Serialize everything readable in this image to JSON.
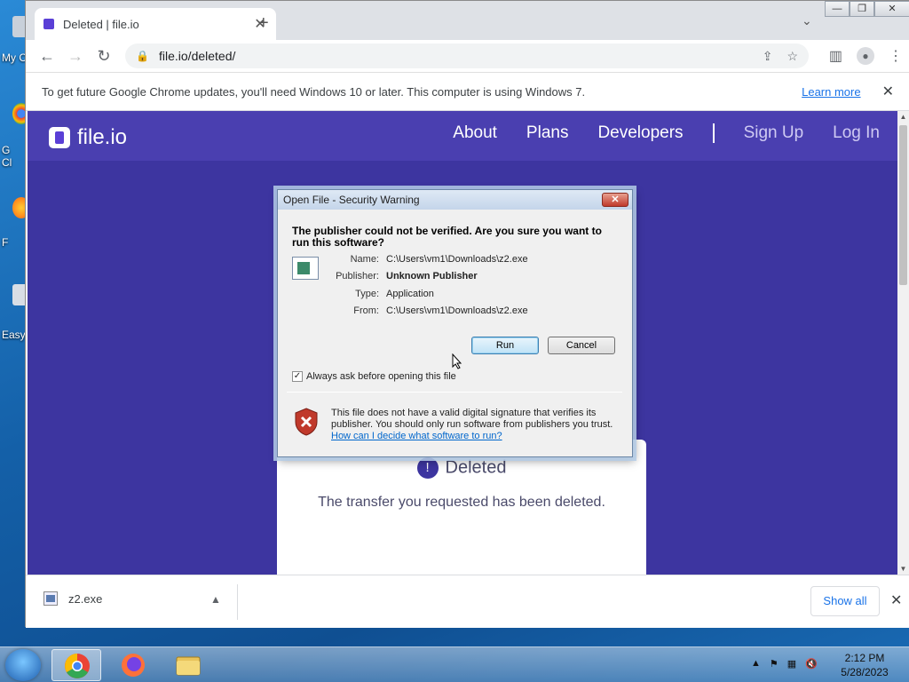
{
  "browser": {
    "tab_title": "Deleted | file.io",
    "tab_close": "✕",
    "new_tab": "+",
    "tab_menu": "⌄",
    "window_buttons": [
      "—",
      "❐",
      "✕"
    ],
    "url": "file.io/deleted/",
    "infobar_message": "To get future Google Chrome updates, you'll need Windows 10 or later. This computer is using Windows 7.",
    "infobar_link": "Learn more",
    "infobar_close": "✕"
  },
  "site": {
    "logo_text": "file.io",
    "nav": {
      "about": "About",
      "plans": "Plans",
      "developers": "Developers",
      "sign_up": "Sign Up",
      "log_in": "Log In"
    },
    "card": {
      "alert_glyph": "!",
      "heading": "Deleted",
      "message": "The transfer you requested has been deleted."
    }
  },
  "dialog": {
    "title": "Open File - Security Warning",
    "question": "The publisher could not be verified.  Are you sure you want to run this software?",
    "fields": [
      {
        "label": "Name:",
        "value": "C:\\Users\\vm1\\Downloads\\z2.exe"
      },
      {
        "label": "Publisher:",
        "value": "Unknown Publisher"
      },
      {
        "label": "Type:",
        "value": "Application"
      },
      {
        "label": "From:",
        "value": "C:\\Users\\vm1\\Downloads\\z2.exe"
      }
    ],
    "run_label": "Run",
    "cancel_label": "Cancel",
    "checkbox_label": "Always ask before opening this file",
    "checkbox_checked": true,
    "warning_text": "This file does not have a valid digital signature that verifies its publisher.  You should only run software from publishers you trust.",
    "warning_link": "How can I decide what software to run?"
  },
  "downloads": {
    "file_name": "z2.exe",
    "show_all": "Show all"
  },
  "desktop": {
    "labels": [
      "My C",
      "G\nCl",
      "F",
      "Easy"
    ]
  },
  "taskbar": {
    "time": "2:12 PM",
    "date": "5/28/2023"
  },
  "colors": {
    "site_bg": "#3d35a0",
    "site_header": "#4a3fb0",
    "link_blue": "#1a73e8"
  }
}
